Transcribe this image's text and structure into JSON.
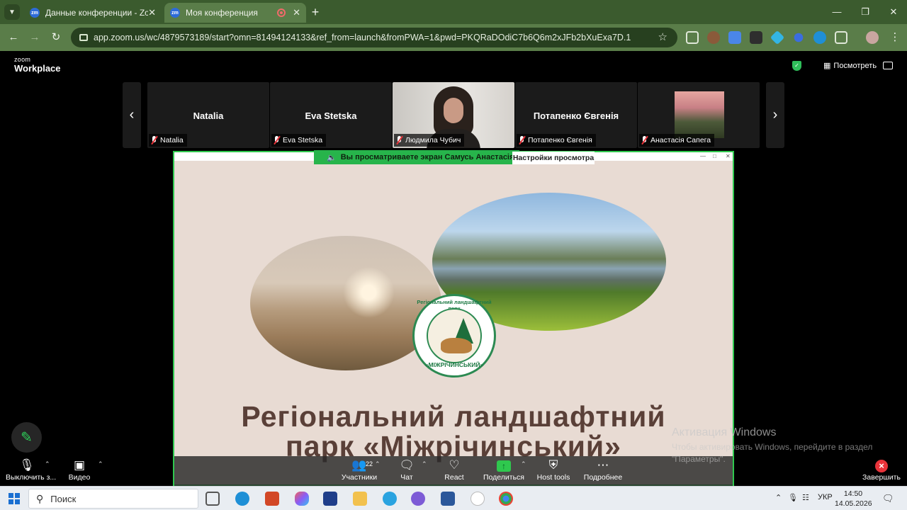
{
  "browser": {
    "tabs": [
      {
        "favicon": "zm",
        "title": "Данные конференции - Zoom",
        "active": false
      },
      {
        "favicon": "zm",
        "title": "Моя конференция",
        "active": true,
        "recording": true
      }
    ],
    "url": "app.zoom.us/wc/4879573189/start?omn=81494124133&ref_from=launch&fromPWA=1&pwd=PKQRaDOdiC7b6Q6m2xJFb2bXuExa7D.1"
  },
  "zoom": {
    "logo_small": "zoom",
    "logo_big": "Workplace",
    "view_label": "Посмотреть",
    "gallery": [
      {
        "name": "Natalia",
        "label": "Natalia",
        "type": "name"
      },
      {
        "name": "Eva Stetska",
        "label": "Eva Stetska",
        "type": "name"
      },
      {
        "name": "",
        "label": "Людмила Чубич",
        "type": "video"
      },
      {
        "name": "Потапенко Євгенія",
        "label": "Потапенко Євгенія",
        "type": "name"
      },
      {
        "name": "",
        "label": "Анастасія Сапега",
        "type": "photo"
      }
    ],
    "share_banner": "Вы просматриваете экран  Самусь Анастасія",
    "view_settings": "Настройки просмотра",
    "slide": {
      "seal_top": "Регіональний ландшафтний парк",
      "seal_bottom": "«МІЖРІЧИНСЬКИЙ»",
      "title_line1": "Регіональний ландшафтний",
      "title_line2": "парк «Міжрічинський»"
    },
    "toolbar": {
      "mute": "Выключить з...",
      "video": "Видео",
      "participants": "Участники",
      "participants_count": "22",
      "chat": "Чат",
      "react": "React",
      "share": "Поделиться",
      "host_tools": "Host tools",
      "more": "Подробнее",
      "end": "Завершить"
    }
  },
  "windows": {
    "activation_title": "Активация Windows",
    "activation_line1": "Чтобы активировать Windows, перейдите в раздел",
    "activation_line2": "\"Параметры\".",
    "search_placeholder": "Поиск",
    "language": "УКР",
    "time": "14:50",
    "date": "14.05.2026"
  }
}
